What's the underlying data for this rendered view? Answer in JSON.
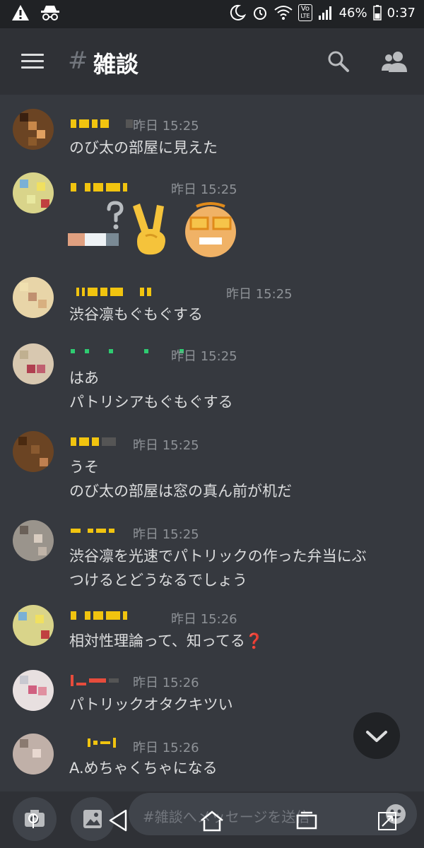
{
  "status_bar": {
    "battery": "46%",
    "clock": "0:37",
    "network_badge_top": "Vo",
    "network_badge_bottom": "LTE"
  },
  "header": {
    "hash": "#",
    "channel": "雑談",
    "icons": [
      "menu-icon",
      "search-icon",
      "members-icon"
    ]
  },
  "messages": [
    {
      "time": "昨日 15:25",
      "lines": [
        "のび太の部屋に見えた"
      ]
    },
    {
      "time": "昨日 15:25",
      "lines": [],
      "emojis": [
        "cigarette-emoji",
        "question-mark",
        "victory-hand-emoji",
        "glasses-face-emoji"
      ]
    },
    {
      "time": "昨日 15:25",
      "lines": [
        "渋谷凛もぐもぐする"
      ]
    },
    {
      "time": "昨日 15:25",
      "lines": [
        "はあ",
        "パトリシアもぐもぐする"
      ]
    },
    {
      "time": "昨日 15:25",
      "lines": [
        "うそ",
        "のび太の部屋は窓の真ん前が机だ"
      ]
    },
    {
      "time": "昨日 15:25",
      "lines": [
        "渋谷凛を光速でパトリックの作った弁当にぶ",
        "つけるとどうなるでしょう"
      ]
    },
    {
      "time": "昨日 15:26",
      "lines": [
        "相対性理論って、知ってる"
      ],
      "trailing_emoji": "❓"
    },
    {
      "time": "昨日 15:26",
      "lines": [
        "パトリックオタクキツい"
      ]
    },
    {
      "time": "昨日 15:26",
      "lines": [
        "A.めちゃくちゃになる"
      ]
    }
  ],
  "composer": {
    "placeholder": "#雑談へメッセージを送信"
  },
  "colors": {
    "background": "#36393f",
    "header": "#2f3136",
    "timestamp": "#8e9297",
    "username_yellow": "#f1c40f",
    "username_green": "#2ecc71",
    "username_red": "#e74c3c"
  }
}
